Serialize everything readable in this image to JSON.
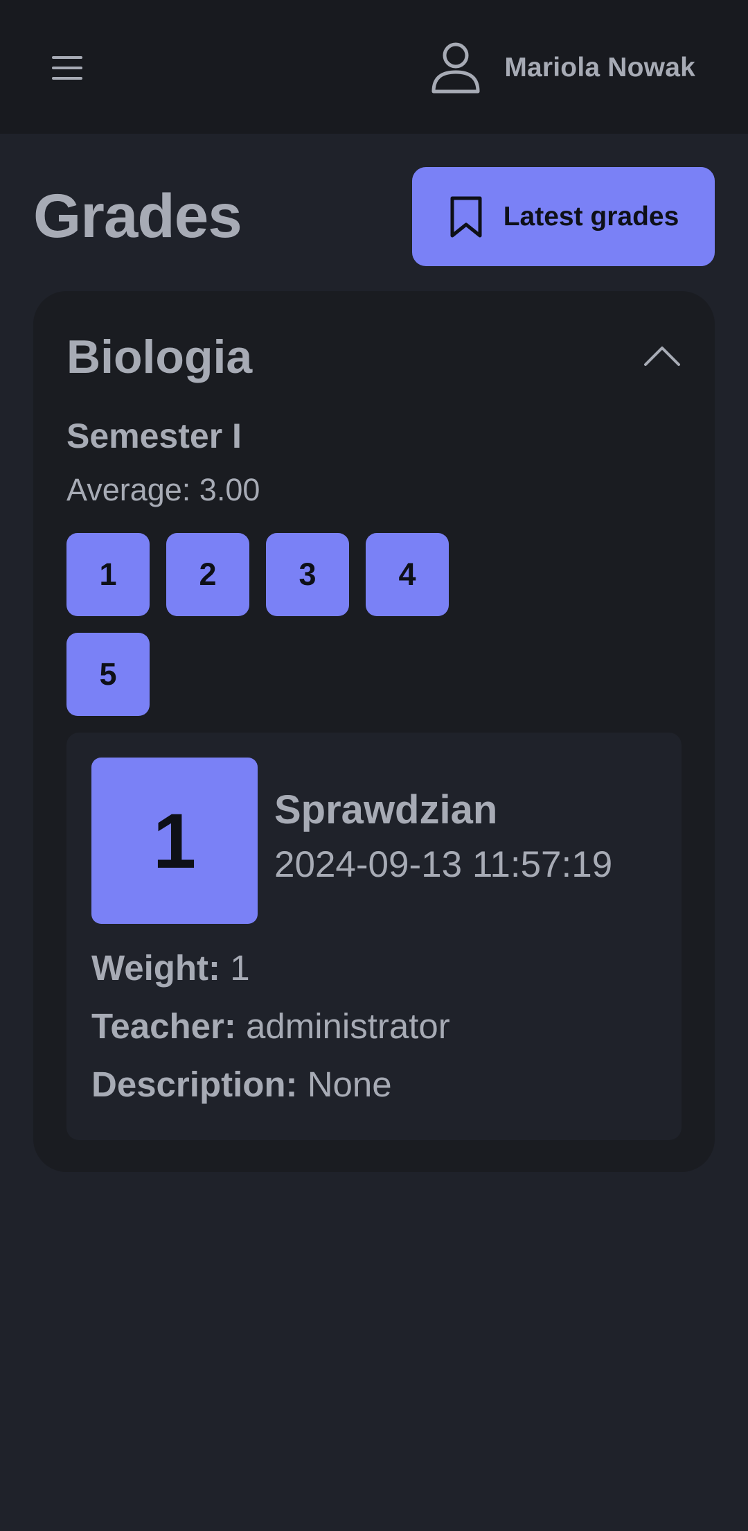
{
  "header": {
    "menu_icon": "hamburger-menu-icon",
    "user_icon": "user-icon",
    "user_name": "Mariola Nowak"
  },
  "page": {
    "title": "Grades",
    "latest_button": {
      "label": "Latest grades",
      "icon": "bookmark-icon"
    }
  },
  "subject_card": {
    "subject": "Biologia",
    "collapse_icon": "chevron-up-icon",
    "semester": "Semester I",
    "average": "Average: 3.00",
    "grades": [
      "1",
      "2",
      "3",
      "4",
      "5"
    ],
    "selected_grade": {
      "value": "1",
      "type": "Sprawdzian",
      "datetime": "2024-09-13 11:57:19",
      "weight_label": "Weight:",
      "weight": "1",
      "teacher_label": "Teacher:",
      "teacher": "administrator",
      "description_label": "Description:",
      "description": "None"
    }
  },
  "colors": {
    "accent": "#7a81f6",
    "background": "#1f222a",
    "topbar": "#181a1f",
    "card": "#1a1c21",
    "text": "#a7abb5"
  }
}
